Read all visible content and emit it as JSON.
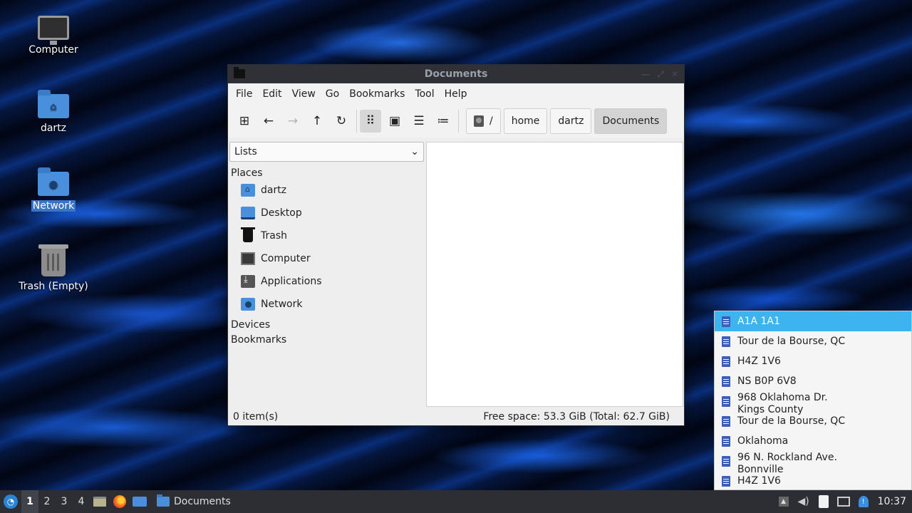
{
  "desktop": {
    "icons": [
      {
        "label": "Computer"
      },
      {
        "label": "dartz"
      },
      {
        "label": "Network"
      },
      {
        "label": "Trash (Empty)"
      }
    ]
  },
  "window": {
    "title": "Documents",
    "menu": [
      "File",
      "Edit",
      "View",
      "Go",
      "Bookmarks",
      "Tool",
      "Help"
    ],
    "path": {
      "root": "/",
      "segments": [
        "home",
        "dartz",
        "Documents"
      ]
    },
    "sidepane": {
      "mode": "Lists",
      "places_heading": "Places",
      "places": [
        "dartz",
        "Desktop",
        "Trash",
        "Computer",
        "Applications",
        "Network"
      ],
      "devices_heading": "Devices",
      "bookmarks_heading": "Bookmarks"
    },
    "status": {
      "items": "0 item(s)",
      "free_space": "Free space: 53.3 GiB (Total: 62.7 GiB)"
    }
  },
  "popup": {
    "items": [
      {
        "line1": "A1A 1A1",
        "line2": ""
      },
      {
        "line1": "Tour de la Bourse, QC",
        "line2": ""
      },
      {
        "line1": "H4Z 1V6",
        "line2": ""
      },
      {
        "line1": "NS B0P 6V8",
        "line2": ""
      },
      {
        "line1": "968 Oklahoma Dr.",
        "line2": "Kings County"
      },
      {
        "line1": "Tour de la Bourse, QC",
        "line2": ""
      },
      {
        "line1": "Oklahoma",
        "line2": ""
      },
      {
        "line1": "96 N. Rockland Ave.",
        "line2": "Bonnville"
      },
      {
        "line1": "H4Z 1V6",
        "line2": ""
      }
    ]
  },
  "taskbar": {
    "workspaces": [
      "1",
      "2",
      "3",
      "4"
    ],
    "task_label": "Documents",
    "clock": "10:37"
  },
  "colors": {
    "accent": "#3db3f0",
    "folder": "#4a8fdc",
    "titlebar": "#2f3136",
    "taskbar": "#2c2e33"
  }
}
